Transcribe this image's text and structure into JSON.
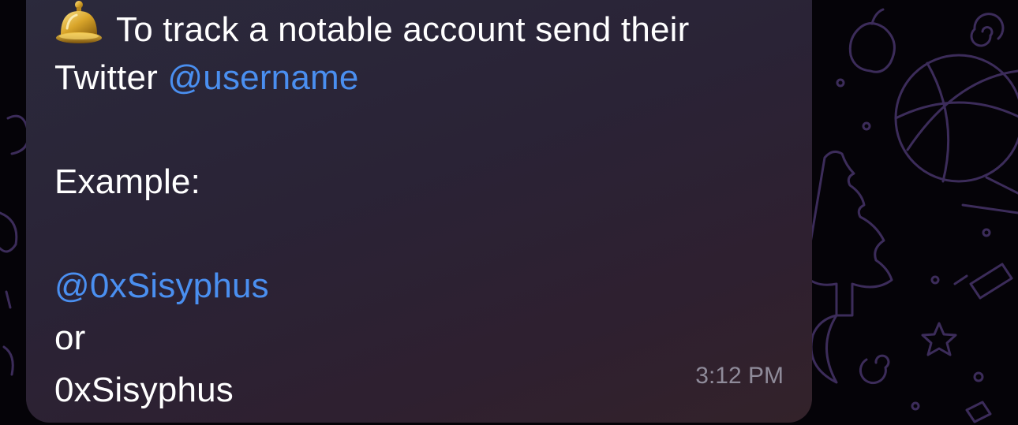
{
  "message": {
    "line1": "To track a notable account send their",
    "line2_prefix": "Twitter",
    "line2_link": "@username",
    "example_label": "Example:",
    "example_link": "@0xSisyphus",
    "or_text": "or",
    "plain_handle": "0xSisyphus",
    "timestamp": "3:12 PM",
    "emoji_icon": "bell-icon"
  },
  "colors": {
    "link": "#4a8ff0",
    "bubble": "#2b2a3c",
    "text": "#ffffff",
    "timestamp": "#8f8b9a"
  }
}
